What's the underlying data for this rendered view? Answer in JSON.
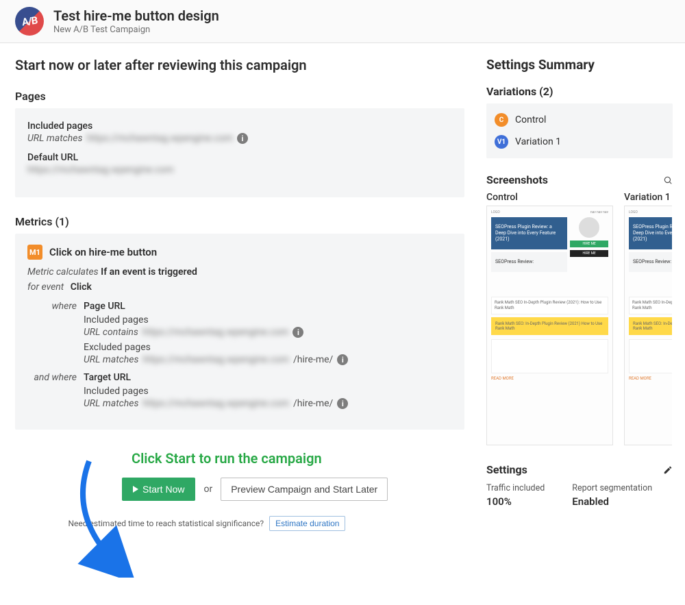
{
  "header": {
    "logo_text": "A/B",
    "title": "Test hire-me button design",
    "subtitle": "New A/B Test Campaign"
  },
  "main": {
    "heading": "Start now or later after reviewing this campaign",
    "pages": {
      "label": "Pages",
      "included_label": "Included pages",
      "url_matches_label": "URL matches",
      "url_matches_value": "https://mchawntag.wpengine.com",
      "default_url_label": "Default URL",
      "default_url_value": "https://mchawntag.wpengine.com"
    },
    "metrics": {
      "label": "Metrics (1)",
      "m1": {
        "badge": "M1",
        "title": "Click on hire-me button",
        "calc_lbl": "Metric calculates",
        "calc_val": "If an event is triggered",
        "event_lbl": "for event",
        "event_val": "Click",
        "where_lbl": "where",
        "where_head": "Page URL",
        "where_inc": "Included pages",
        "where_contains_lbl": "URL contains",
        "where_contains_val": "https://mchawntag.wpengine.com",
        "where_exc": "Excluded pages",
        "where_matches_lbl": "URL matches",
        "where_matches_val": "https://mchawntag.wpengine.com",
        "where_matches_suffix": "/hire-me/",
        "andwhere_lbl": "and where",
        "andwhere_head": "Target URL",
        "andwhere_inc": "Included pages",
        "andwhere_matches_lbl": "URL matches",
        "andwhere_matches_val": "https://mchawntag.wpengine.com",
        "andwhere_matches_suffix": "/hire-me/"
      }
    },
    "callout": "Click Start to run the campaign",
    "start_btn": "Start Now",
    "or": "or",
    "preview_btn": "Preview Campaign and Start Later",
    "estimate_q": "Need estimated time to reach statistical significance?",
    "estimate_btn": "Estimate duration"
  },
  "sidebar": {
    "heading": "Settings Summary",
    "variations": {
      "label": "Variations (2)",
      "items": [
        {
          "badge": "C",
          "label": "Control"
        },
        {
          "badge": "V1",
          "label": "Variation 1"
        }
      ]
    },
    "screenshots": {
      "label": "Screenshots",
      "cols": [
        {
          "label": "Control"
        },
        {
          "label": "Variation 1"
        }
      ],
      "mock": {
        "hero1": "SEOPress Plugin Review: a Deep Dive into Every Feature (2021)",
        "hero2": "SEOPress Review:",
        "btn_green": "HIRE ME",
        "btn_dark": "HIRE ME",
        "block1": "Rank Math SEO In-Depth Plugin Review (2021): How to Use Rank Math",
        "yellow": "Rank Math SEO: In-Depth Plugin Review (2021) How to Use Rank Math",
        "more": "READ MORE"
      }
    },
    "settings": {
      "label": "Settings",
      "traffic_k": "Traffic included",
      "traffic_v": "100%",
      "seg_k": "Report segmentation",
      "seg_v": "Enabled"
    }
  }
}
